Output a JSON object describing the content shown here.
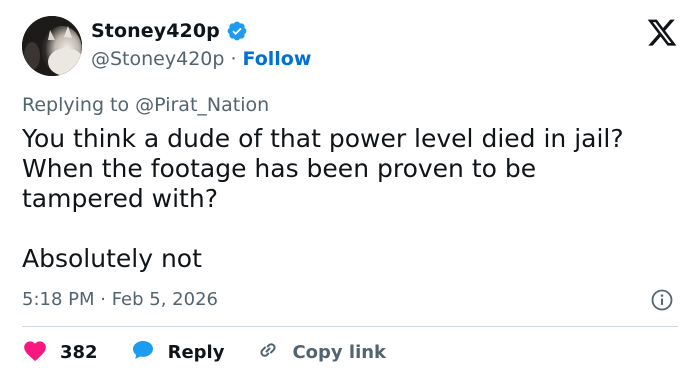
{
  "user": {
    "display_name": "Stoney420p",
    "handle": "@Stoney420p",
    "separator": "·",
    "follow_label": "Follow",
    "verified": true
  },
  "reply_to": {
    "prefix": "Replying to",
    "mention": "@Pirat_Nation"
  },
  "tweet": {
    "text": "You think a dude of that power level died in jail?\nWhen the footage has been proven to be\ntampered with?\n\nAbsolutely not",
    "timestamp": "5:18 PM · Feb 5, 2026"
  },
  "actions": {
    "like_count": "382",
    "reply_label": "Reply",
    "copy_link_label": "Copy link"
  },
  "colors": {
    "text_primary": "#0f1419",
    "text_secondary": "#536471",
    "follow_blue": "#006fd6",
    "verified_blue": "#1d9bf0",
    "like_red": "#f91880",
    "reply_blue": "#1d9bf0",
    "divider": "#cfd9de"
  },
  "icons": {
    "logo": "x-logo-icon",
    "verified": "verified-badge-icon",
    "info": "info-icon",
    "like": "heart-icon",
    "reply": "reply-bubble-icon",
    "copy_link": "link-icon"
  }
}
